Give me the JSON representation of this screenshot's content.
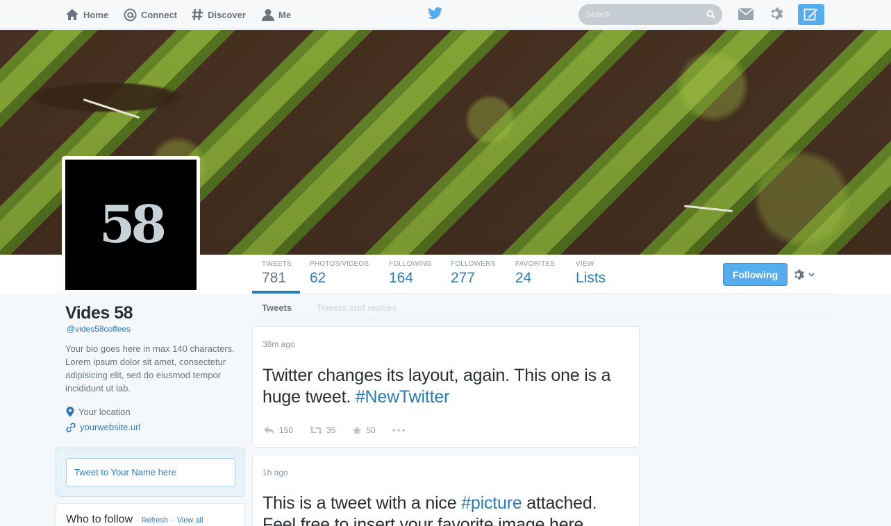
{
  "nav": {
    "home": "Home",
    "connect": "Connect",
    "discover": "Discover",
    "me": "Me",
    "search_placeholder": "Search"
  },
  "profile": {
    "avatar_text": "58",
    "name": "Vides 58",
    "handle": "@vides58coffees",
    "bio": "Your bio goes here in max 140 characters. Lorem ipsum dolor sit amet, consectetur adipisicing elit, sed do eiusmod tempor incididunt ut lab.",
    "location": "Your location",
    "website": "yourwebsite.url",
    "tweet_to_placeholder": "Tweet to Your Name here"
  },
  "stats": [
    {
      "label": "TWEETS",
      "value": "781"
    },
    {
      "label": "PHOTOS/VIDEOS",
      "value": "62"
    },
    {
      "label": "FOLLOWING",
      "value": "164"
    },
    {
      "label": "FOLLOWERS",
      "value": "277"
    },
    {
      "label": "FAVORITES",
      "value": "24"
    },
    {
      "label": "VIEW",
      "value": "Lists"
    }
  ],
  "following_button": "Following",
  "tabs": {
    "tweets": "Tweets",
    "tweets_and_replies": "Tweets and replies"
  },
  "who_to_follow": {
    "title": "Who to follow",
    "sep": "·",
    "refresh": "Refresh",
    "view_all": "View all"
  },
  "tweets": [
    {
      "time": "38m ago",
      "text": "Twitter changes its layout, again. This one is a huge tweet. ",
      "hashtag": "#NewTwitter",
      "replies": "150",
      "retweets": "35",
      "favorites": "50"
    },
    {
      "time": "1h ago",
      "text_before": "This is a tweet with a nice ",
      "hashtag": "#picture",
      "text_after": " attached. Feel free to insert your favorite image here."
    }
  ],
  "colors": {
    "accent": "#55acee",
    "link": "#2b7bb9",
    "muted": "#8899a6"
  }
}
